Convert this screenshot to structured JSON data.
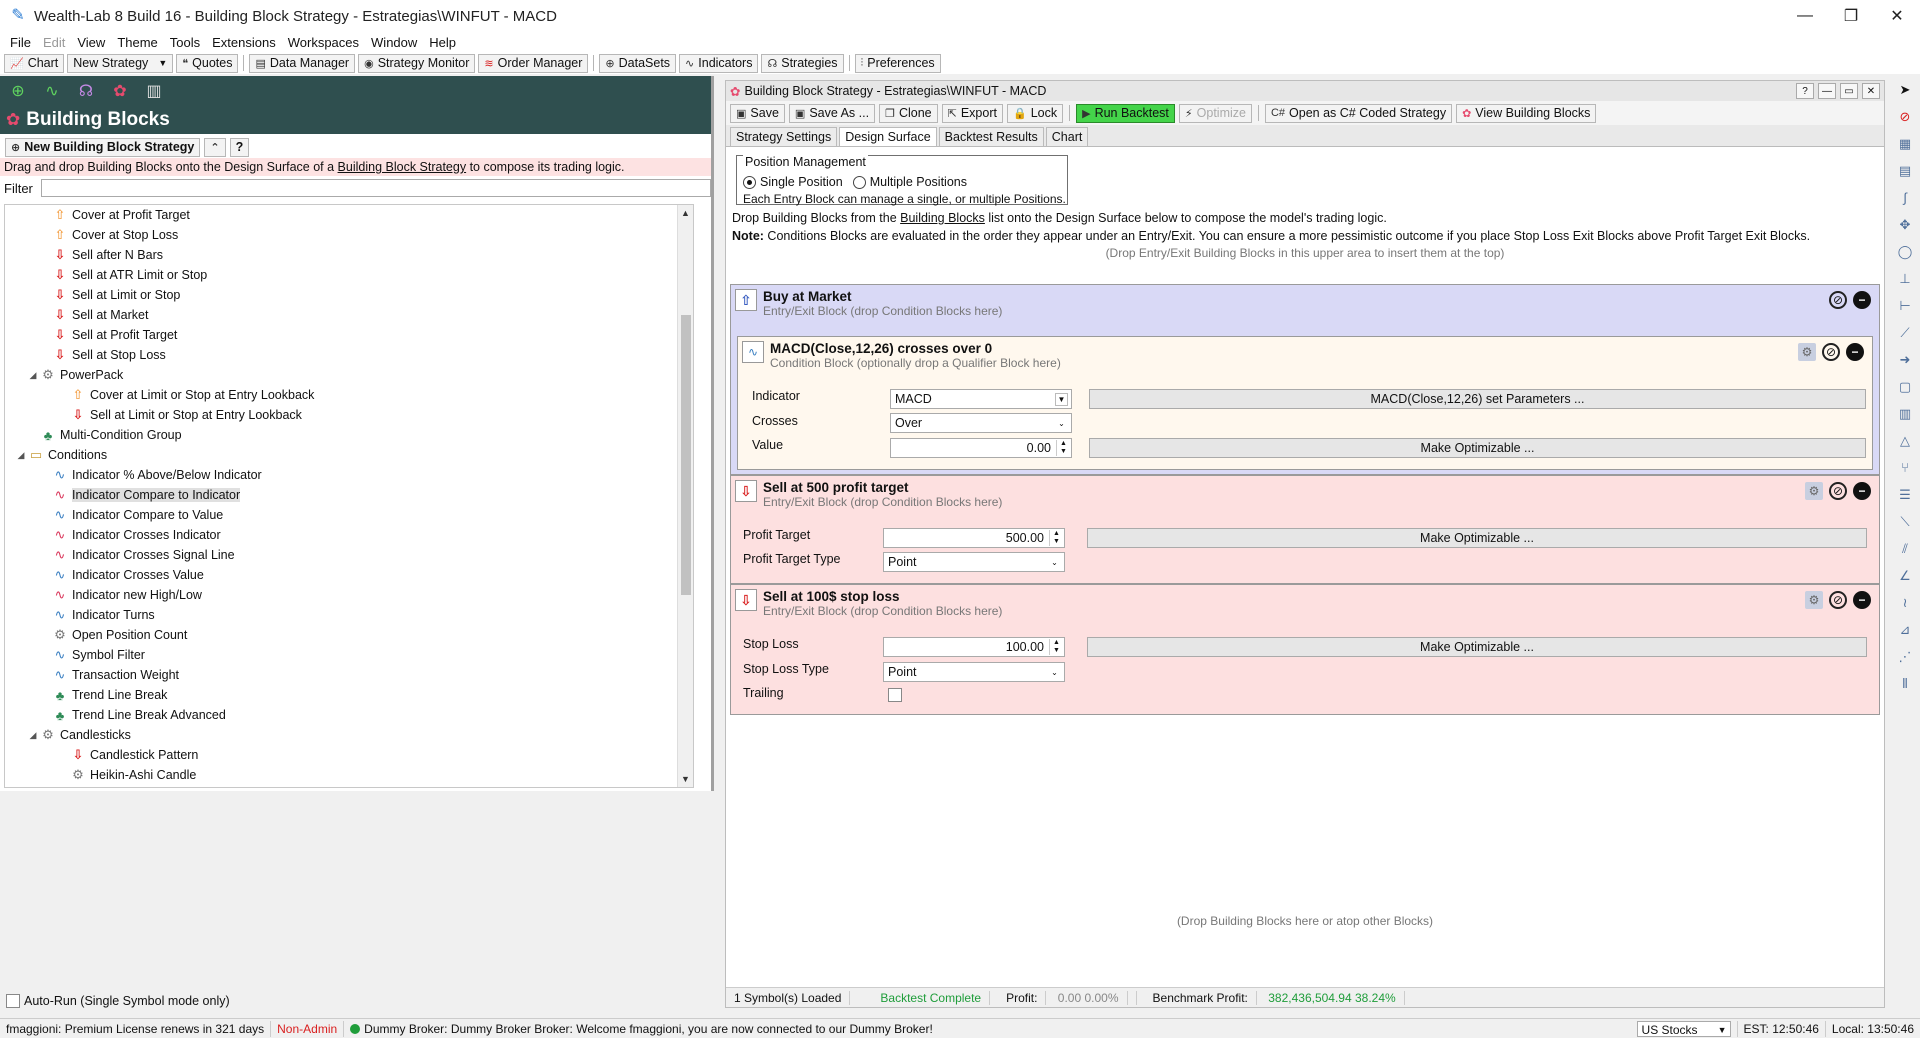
{
  "window": {
    "title": "Wealth-Lab 8 Build 16 - Building Block Strategy - Estrategias\\WINFUT - MACD"
  },
  "menu": [
    "File",
    "Edit",
    "View",
    "Theme",
    "Tools",
    "Extensions",
    "Workspaces",
    "Window",
    "Help"
  ],
  "toolbar": {
    "chart": "Chart",
    "new_strategy": "New Strategy",
    "quotes": "Quotes",
    "data_manager": "Data Manager",
    "strategy_monitor": "Strategy Monitor",
    "order_manager": "Order Manager",
    "datasets": "DataSets",
    "indicators": "Indicators",
    "strategies": "Strategies",
    "preferences": "Preferences"
  },
  "left": {
    "header": "Building Blocks",
    "new_button": "New Building Block Strategy",
    "help_button": "?",
    "info_pre": "Drag and drop Building Blocks onto the Design Surface of a ",
    "info_link": "Building Block Strategy",
    "info_post": " to compose its trading logic.",
    "filter_label": "Filter",
    "tree": [
      {
        "label": "Cover at Profit Target",
        "icon": "up",
        "level": 2
      },
      {
        "label": "Cover at Stop Loss",
        "icon": "up",
        "level": 2
      },
      {
        "label": "Sell after N Bars",
        "icon": "down",
        "level": 2
      },
      {
        "label": "Sell at ATR Limit or Stop",
        "icon": "down",
        "level": 2
      },
      {
        "label": "Sell at Limit or Stop",
        "icon": "down",
        "level": 2
      },
      {
        "label": "Sell at Market",
        "icon": "down",
        "level": 2
      },
      {
        "label": "Sell at Profit Target",
        "icon": "down",
        "level": 2
      },
      {
        "label": "Sell at Stop Loss",
        "icon": "down",
        "level": 2
      },
      {
        "label": "PowerPack",
        "icon": "gear",
        "level": 1,
        "expander": "◢"
      },
      {
        "label": "Cover at Limit or Stop at Entry Lookback",
        "icon": "up",
        "level": 3
      },
      {
        "label": "Sell at Limit or Stop at Entry Lookback",
        "icon": "down",
        "level": 3
      },
      {
        "label": "Multi-Condition Group",
        "icon": "green",
        "level": 1
      },
      {
        "label": "Conditions",
        "icon": "folder",
        "level": 0,
        "expander": "◢"
      },
      {
        "label": "Indicator % Above/Below Indicator",
        "icon": "wave",
        "level": 2
      },
      {
        "label": "Indicator Compare to Indicator",
        "icon": "wave2",
        "level": 2,
        "selected": true
      },
      {
        "label": "Indicator Compare to Value",
        "icon": "wave",
        "level": 2
      },
      {
        "label": "Indicator Crosses Indicator",
        "icon": "wave2",
        "level": 2
      },
      {
        "label": "Indicator Crosses Signal Line",
        "icon": "wave2",
        "level": 2
      },
      {
        "label": "Indicator Crosses Value",
        "icon": "wave",
        "level": 2
      },
      {
        "label": "Indicator new High/Low",
        "icon": "wave2",
        "level": 2
      },
      {
        "label": "Indicator Turns",
        "icon": "wave",
        "level": 2
      },
      {
        "label": "Open Position Count",
        "icon": "gear",
        "level": 2
      },
      {
        "label": "Symbol Filter",
        "icon": "wave",
        "level": 2
      },
      {
        "label": "Transaction Weight",
        "icon": "wave",
        "level": 2
      },
      {
        "label": "Trend Line Break",
        "icon": "green",
        "level": 2
      },
      {
        "label": "Trend Line Break Advanced",
        "icon": "green",
        "level": 2
      },
      {
        "label": "Candlesticks",
        "icon": "gear",
        "level": 1,
        "expander": "◢"
      },
      {
        "label": "Candlestick Pattern",
        "icon": "down",
        "level": 3
      },
      {
        "label": "Heikin-Ashi Candle",
        "icon": "gear",
        "level": 3
      }
    ],
    "autorun_label": "Auto-Run (Single Symbol mode only)"
  },
  "doc": {
    "title": "Building Block Strategy - Estrategias\\WINFUT - MACD",
    "buttons": {
      "save": "Save",
      "save_as": "Save As ...",
      "clone": "Clone",
      "export": "Export",
      "lock": "Lock",
      "run_backtest": "Run Backtest",
      "optimize": "Optimize",
      "open_cs": "Open as C# Coded Strategy",
      "view_blocks": "View Building Blocks"
    },
    "tabs": [
      "Strategy Settings",
      "Design Surface",
      "Backtest Results",
      "Chart"
    ],
    "active_tab": "Design Surface",
    "position_management": {
      "legend": "Position Management",
      "single": "Single Position",
      "multiple": "Multiple Positions",
      "note": "Each Entry Block can manage a single, or multiple Positions."
    },
    "desc1_pre": "Drop Building Blocks from the ",
    "desc1_link": "Building Blocks",
    "desc1_post": " list onto the Design Surface below to compose the model's trading logic.",
    "desc2_bold": "Note:",
    "desc2_text": " Conditions Blocks are evaluated in the order they appear under an Entry/Exit. You can ensure a more pessimistic outcome if you place Stop Loss Exit Blocks above Profit Target Exit Blocks.",
    "desc3": "(Drop Entry/Exit Building Blocks in this upper area to insert them at the top)",
    "blocks": {
      "buy": {
        "title": "Buy at Market",
        "sub": "Entry/Exit Block (drop Condition Blocks here)"
      },
      "macd": {
        "title": "MACD(Close,12,26) crosses over 0",
        "sub": "Condition Block (optionally drop a Qualifier Block here)",
        "indicator_label": "Indicator",
        "indicator_value": "MACD",
        "params_button": "MACD(Close,12,26) set Parameters ...",
        "crosses_label": "Crosses",
        "crosses_value": "Over",
        "value_label": "Value",
        "value_value": "0.00",
        "optimizable": "Make Optimizable ..."
      },
      "sell1": {
        "title": "Sell at 500 profit target",
        "sub": "Entry/Exit Block (drop Condition Blocks here)",
        "pt_label": "Profit Target",
        "pt_value": "500.00",
        "ptt_label": "Profit Target Type",
        "ptt_value": "Point",
        "optimizable": "Make Optimizable ..."
      },
      "sell2": {
        "title": "Sell at 100$ stop loss",
        "sub": "Entry/Exit Block (drop Condition Blocks here)",
        "sl_label": "Stop Loss",
        "sl_value": "100.00",
        "slt_label": "Stop Loss Type",
        "slt_value": "Point",
        "trailing_label": "Trailing",
        "optimizable": "Make Optimizable ..."
      }
    },
    "drop_note": "(Drop Building Blocks here or atop other Blocks)",
    "status": {
      "symbols": "1 Symbol(s) Loaded",
      "backtest": "Backtest Complete",
      "profit_label": "Profit:",
      "profit_value": "0.00 0.00%",
      "benchmark_label": "Benchmark Profit:",
      "benchmark_value": "382,436,504.94 38.24%"
    }
  },
  "statusbar": {
    "license": "fmaggioni: Premium License renews in 321 days",
    "admin": "Non-Admin",
    "broker": "Dummy Broker: Dummy Broker Broker: Welcome fmaggioni, you are now connected to our Dummy Broker!",
    "market": "US Stocks",
    "est": "EST: 12:50:46",
    "local": "Local: 13:50:46"
  },
  "colors": {
    "accent_green": "#44d44a",
    "header_dark": "#2f4f4f",
    "entry_block": "#d9d9f6",
    "exit_block": "#fde0e0"
  }
}
